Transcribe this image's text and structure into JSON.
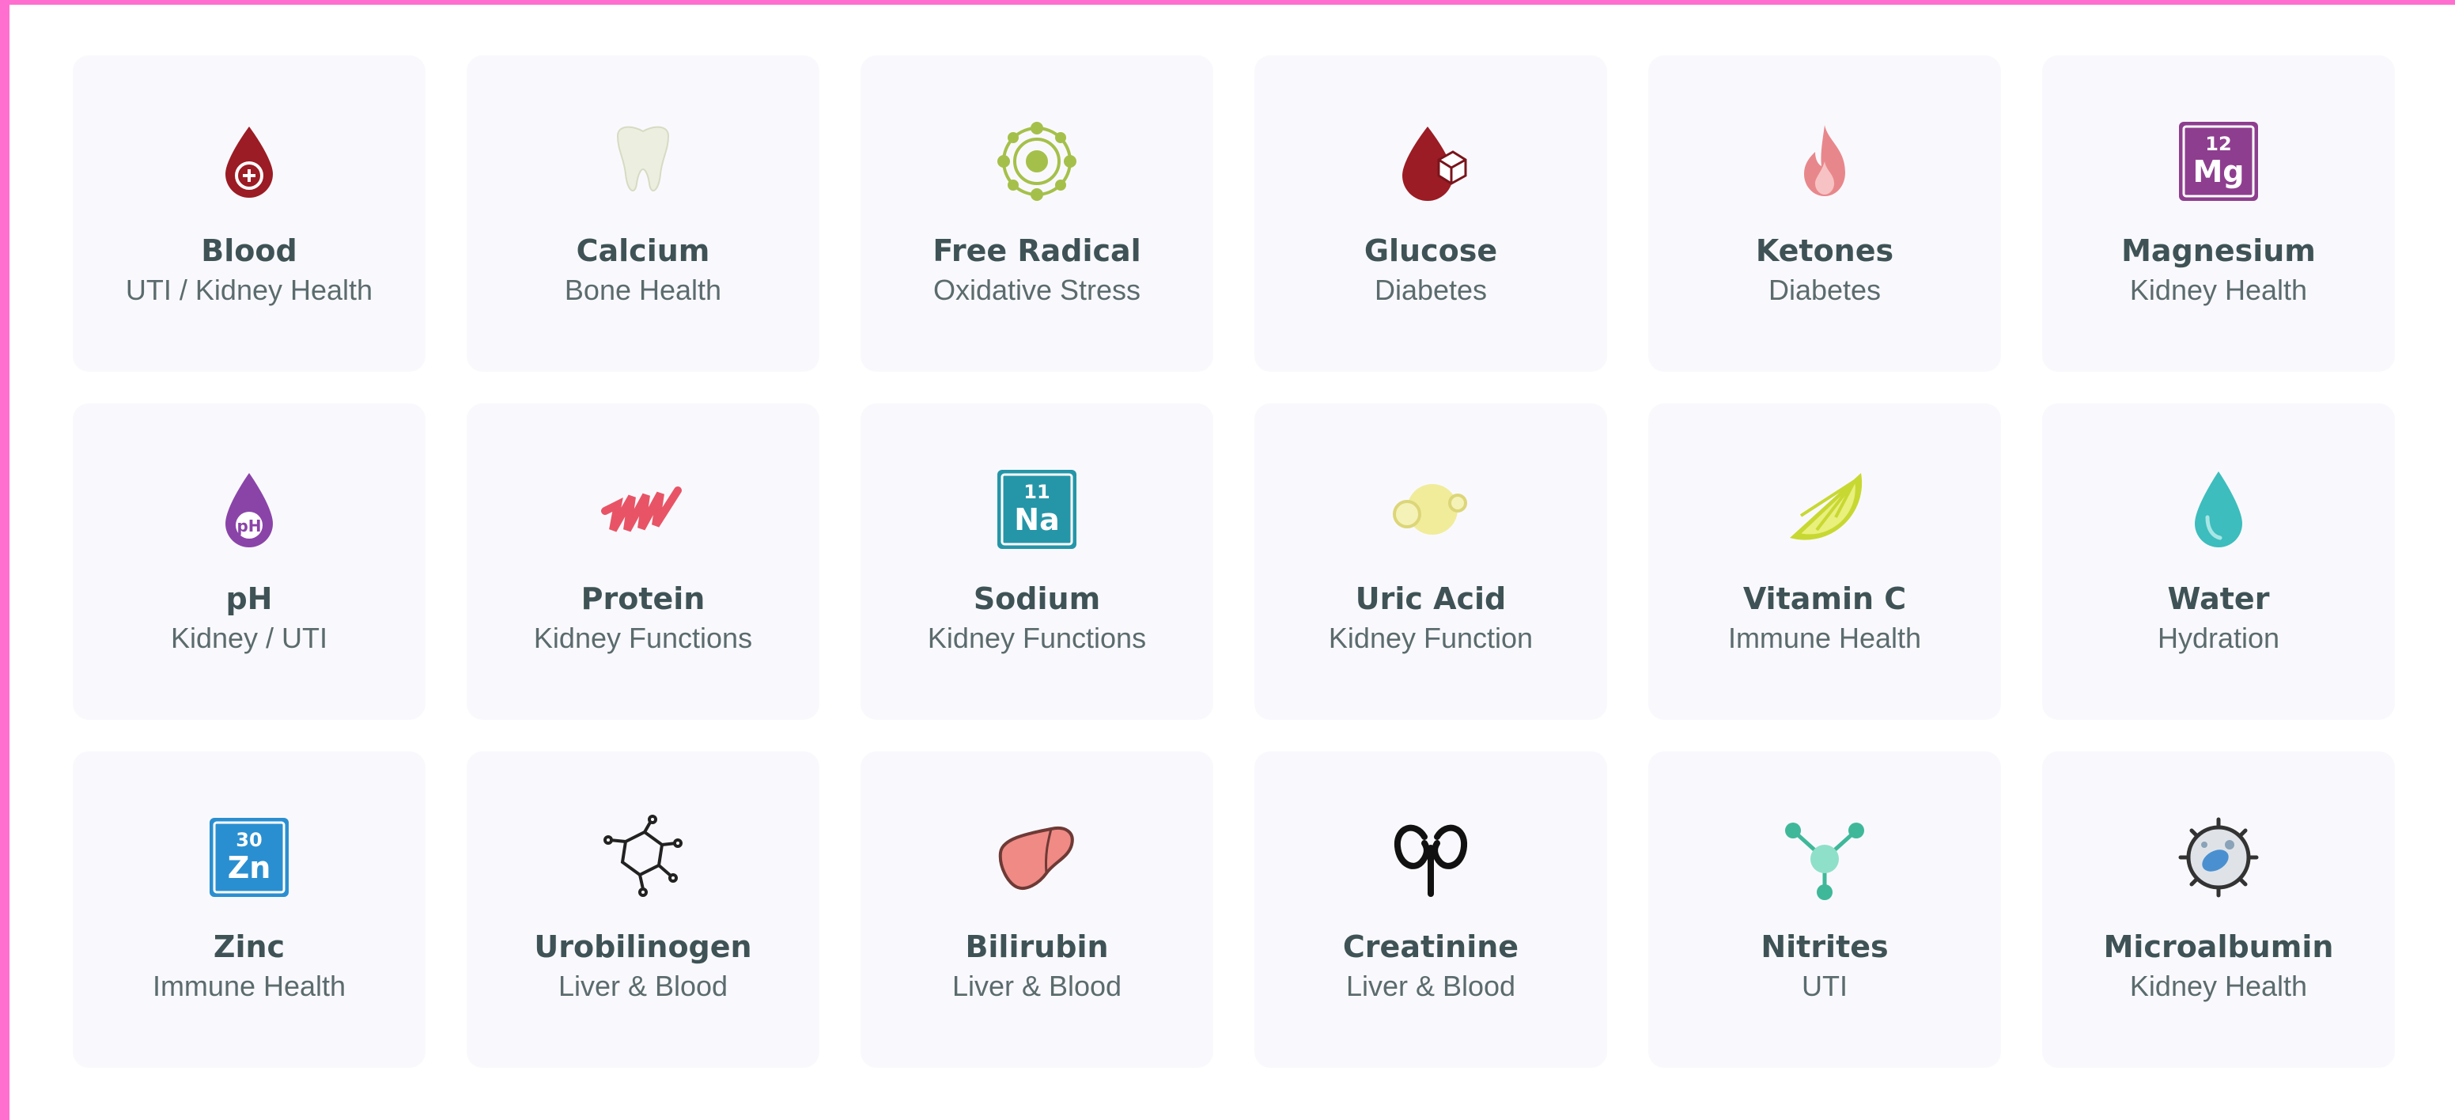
{
  "cards": [
    {
      "title": "Blood",
      "subtitle": "UTI / Kidney Health",
      "icon": "blood-drop-icon"
    },
    {
      "title": "Calcium",
      "subtitle": "Bone Health",
      "icon": "tooth-icon"
    },
    {
      "title": "Free Radical",
      "subtitle": "Oxidative Stress",
      "icon": "atom-icon"
    },
    {
      "title": "Glucose",
      "subtitle": "Diabetes",
      "icon": "glucose-drop-icon"
    },
    {
      "title": "Ketones",
      "subtitle": "Diabetes",
      "icon": "flame-icon"
    },
    {
      "title": "Magnesium",
      "subtitle": "Kidney Health",
      "icon": "magnesium-element-icon",
      "element": {
        "number": "12",
        "symbol": "Mg"
      }
    },
    {
      "title": "pH",
      "subtitle": "Kidney / UTI",
      "icon": "ph-drop-icon",
      "drop_label": "pH"
    },
    {
      "title": "Protein",
      "subtitle": "Kidney Functions",
      "icon": "protein-helix-icon"
    },
    {
      "title": "Sodium",
      "subtitle": "Kidney Functions",
      "icon": "sodium-element-icon",
      "element": {
        "number": "11",
        "symbol": "Na"
      }
    },
    {
      "title": "Uric Acid",
      "subtitle": "Kidney Function",
      "icon": "crystal-icon"
    },
    {
      "title": "Vitamin C",
      "subtitle": "Immune Health",
      "icon": "lime-slice-icon"
    },
    {
      "title": "Water",
      "subtitle": "Hydration",
      "icon": "water-drop-icon"
    },
    {
      "title": "Zinc",
      "subtitle": "Immune Health",
      "icon": "zinc-element-icon",
      "element": {
        "number": "30",
        "symbol": "Zn"
      }
    },
    {
      "title": "Urobilinogen",
      "subtitle": "Liver & Blood",
      "icon": "molecule-icon"
    },
    {
      "title": "Bilirubin",
      "subtitle": "Liver & Blood",
      "icon": "liver-icon"
    },
    {
      "title": "Creatinine",
      "subtitle": "Liver & Blood",
      "icon": "kidneys-icon"
    },
    {
      "title": "Nitrites",
      "subtitle": "UTI",
      "icon": "nitrite-molecule-icon"
    },
    {
      "title": "Microalbumin",
      "subtitle": "Kidney Health",
      "icon": "cell-icon"
    }
  ],
  "colors": {
    "frame": "#ff6fcf",
    "card_bg": "#f9f9fd",
    "title": "#3f5356",
    "subtitle": "#5b6b6e"
  }
}
